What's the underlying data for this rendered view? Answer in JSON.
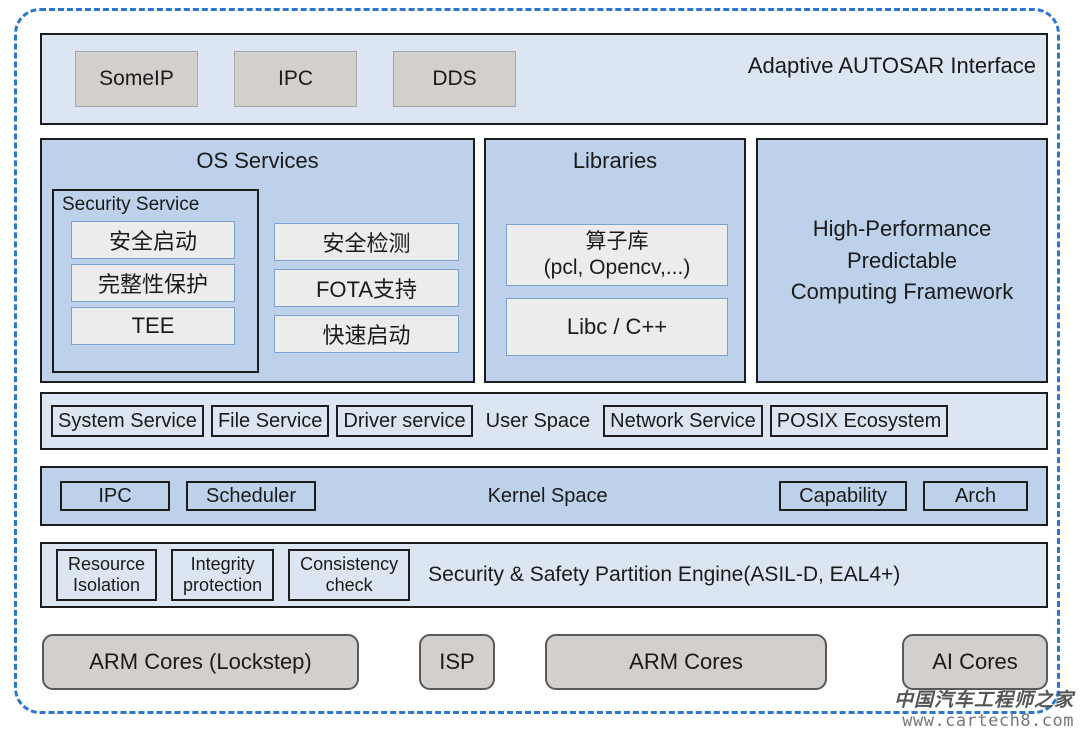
{
  "frame": {
    "style": "dashed-rounded",
    "color": "#2e77d0"
  },
  "top_band": {
    "chips": [
      {
        "label": "SomeIP"
      },
      {
        "label": "IPC"
      },
      {
        "label": "DDS"
      }
    ],
    "title": "Adaptive AUTOSAR Interface"
  },
  "os_services": {
    "title": "OS Services",
    "security_service": {
      "title": "Security Service",
      "items": [
        {
          "label": "安全启动"
        },
        {
          "label": "完整性保护"
        },
        {
          "label": "TEE"
        }
      ]
    },
    "right_items": [
      {
        "label": "安全检测"
      },
      {
        "label": "FOTA支持"
      },
      {
        "label": "快速启动"
      }
    ]
  },
  "libraries": {
    "title": "Libraries",
    "items": [
      {
        "line1": "算子库",
        "line2": "(pcl, Opencv,...)"
      },
      {
        "line1": "Libc / C++"
      }
    ]
  },
  "hpc": {
    "label": "High-Performance\nPredictable\nComputing Framework",
    "line1": "High-Performance",
    "line2": "Predictable",
    "line3": "Computing Framework"
  },
  "user_space": {
    "label": "User Space",
    "left_boxes": [
      {
        "label": "System Service"
      },
      {
        "label": "File Service"
      },
      {
        "label": "Driver service"
      }
    ],
    "right_boxes": [
      {
        "label": "Network Service"
      },
      {
        "label": "POSIX Ecosystem"
      }
    ]
  },
  "kernel_space": {
    "label": "Kernel Space",
    "left_boxes": [
      {
        "label": "IPC"
      },
      {
        "label": "Scheduler"
      }
    ],
    "right_boxes": [
      {
        "label": "Capability"
      },
      {
        "label": "Arch"
      }
    ]
  },
  "safety": {
    "boxes": [
      {
        "line1": "Resource",
        "line2": "Isolation"
      },
      {
        "line1": "Integrity",
        "line2": "protection"
      },
      {
        "line1": "Consistency",
        "line2": "check"
      }
    ],
    "label": "Security & Safety  Partition Engine(ASIL-D, EAL4+)"
  },
  "hardware": {
    "chips": [
      {
        "label": "ARM Cores (Lockstep)"
      },
      {
        "label": "ISP"
      },
      {
        "label": "ARM Cores"
      },
      {
        "label": "AI Cores"
      }
    ]
  },
  "watermark": {
    "cn": "中国汽车工程师之家",
    "url": "www.cartech8.com"
  },
  "colors": {
    "frame_dashed": "#2e77d0",
    "band_light": "#dce6f2",
    "band_mid": "#bdd1ea",
    "gray_chip": "#d2cfcd",
    "lite_block": "#ececec",
    "outline": "#1d1d1d"
  }
}
